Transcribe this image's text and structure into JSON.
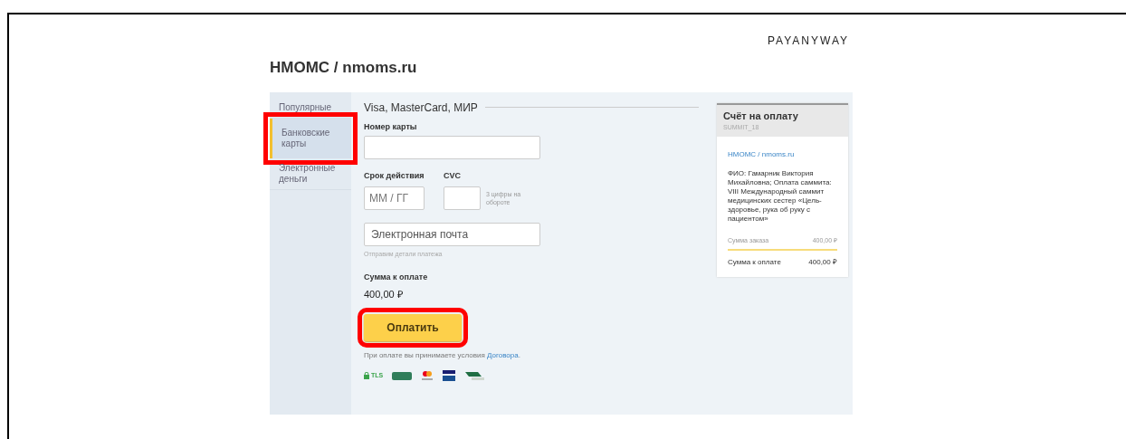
{
  "logo": "PAYANYWAY",
  "title": "НМОМС / nmoms.ru",
  "sidebar": {
    "items": [
      {
        "label": "Популярные",
        "selected": false,
        "highlighted": false
      },
      {
        "label": "Банковские карты",
        "selected": true,
        "highlighted": true
      },
      {
        "label": "Электронные деньги",
        "selected": false,
        "highlighted": false
      }
    ]
  },
  "form": {
    "section_title": "Visa, MasterCard, МИР",
    "card_number": {
      "label": "Номер карты"
    },
    "expiry": {
      "label": "Срок действия",
      "placeholder": "ММ / ГГ"
    },
    "cvc": {
      "label": "CVC",
      "hint": "3 цифры на обороте"
    },
    "email": {
      "placeholder": "Электронная почта",
      "hint": "Отправим детали платежа"
    },
    "amount_label": "Сумма к оплате",
    "amount": "400,00 ₽",
    "pay_button": {
      "label": "Оплатить",
      "highlighted": true
    },
    "terms": {
      "text": "При оплате вы принимаете условия ",
      "link": "Договора",
      "end": "."
    },
    "security": {
      "tls": "TLS"
    }
  },
  "invoice": {
    "title": "Счёт на оплату",
    "code": "SUMMIT_18",
    "merchant": "НМОМС / nmoms.ru",
    "description": "ФИО: Гамарник Виктория Михайловна; Оплата саммита: VIII Международный саммит медицинских сестер «Цель-здоровье, рука об руку с пациентом»",
    "order_label": "Сумма заказа",
    "order_value": "400,00 ₽",
    "total_label": "Сумма к оплате",
    "total_value": "400,00 ₽"
  }
}
